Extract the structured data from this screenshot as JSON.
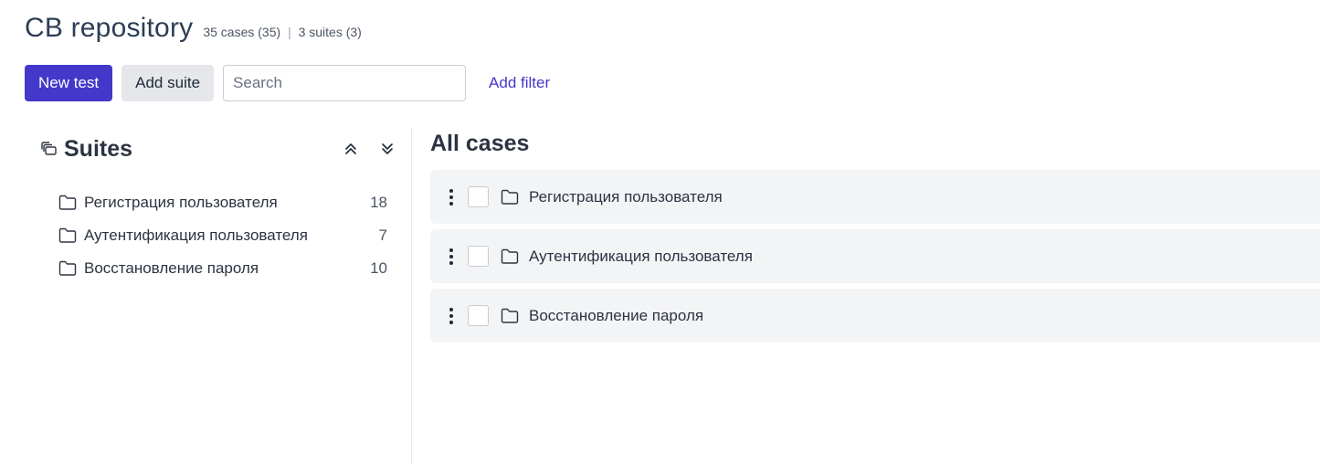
{
  "header": {
    "title": "CB repository",
    "cases": "35 cases (35)",
    "separator": "|",
    "suites": "3 suites (3)"
  },
  "toolbar": {
    "new_test_label": "New test",
    "add_suite_label": "Add suite",
    "search_placeholder": "Search",
    "search_value": "",
    "add_filter_label": "Add filter"
  },
  "sidebar": {
    "title": "Suites",
    "icons": [
      "stack-icon",
      "chevrons-up-icon",
      "chevrons-down-icon"
    ],
    "items": [
      {
        "label": "Регистрация пользователя",
        "count": "18",
        "icon": "folder-icon"
      },
      {
        "label": "Аутентификация пользователя",
        "count": "7",
        "icon": "folder-icon"
      },
      {
        "label": "Восстановление пароля",
        "count": "10",
        "icon": "folder-icon"
      }
    ]
  },
  "main": {
    "title": "All cases",
    "rows": [
      {
        "label": "Регистрация пользователя",
        "icon": "folder-icon"
      },
      {
        "label": "Аутентификация пользователя",
        "icon": "folder-icon"
      },
      {
        "label": "Восстановление пароля",
        "icon": "folder-icon"
      }
    ]
  },
  "colors": {
    "primary": "#4338ca",
    "title": "#2d3e55",
    "row_bg": "#f3f4f6",
    "secondary_btn": "#e5e7eb"
  }
}
